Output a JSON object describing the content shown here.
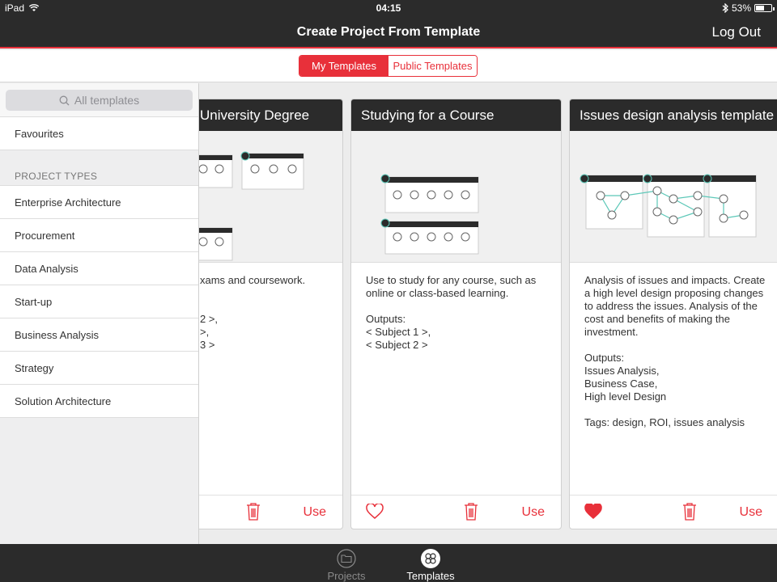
{
  "status_bar": {
    "device": "iPad",
    "time": "04:15",
    "battery": "53%",
    "battery_level": 0.53
  },
  "nav": {
    "title": "Create Project From Template",
    "logout_label": "Log Out"
  },
  "segments": {
    "my_templates": "My Templates",
    "public_templates": "Public Templates",
    "selected": "my_templates"
  },
  "sidebar": {
    "search_placeholder": "All templates",
    "favourites": "Favourites",
    "section_title": "PROJECT TYPES",
    "items": [
      "Enterprise Architecture",
      "Procurement",
      "Data Analysis",
      "Start-up",
      "Business Analysis",
      "Strategy",
      "Solution Architecture"
    ]
  },
  "cards": [
    {
      "title": "University Degree",
      "description": "xams and coursework.\n\n\n2 >,\n >,\n3 >",
      "use_label": "Use",
      "favourite": false
    },
    {
      "title": "Studying for a Course",
      "description": "Use to study for any course, such as online or class-based learning.\n\nOutputs:\n< Subject 1 >,\n< Subject 2 >",
      "use_label": "Use",
      "favourite": false
    },
    {
      "title": "Issues design analysis template",
      "description": "Analysis of issues and impacts. Create a high level design proposing changes to address the issues. Analysis of the cost and benefits of making the investment.\n\nOutputs:\nIssues Analysis,\nBusiness Case,\nHigh level Design\n\nTags: design, ROI, issues analysis",
      "use_label": "Use",
      "favourite": true
    }
  ],
  "tabbar": {
    "projects": "Projects",
    "templates": "Templates",
    "selected": "templates"
  },
  "colors": {
    "accent": "#e8303a",
    "dark": "#2b2b2b",
    "teal": "#5cc8b8"
  }
}
